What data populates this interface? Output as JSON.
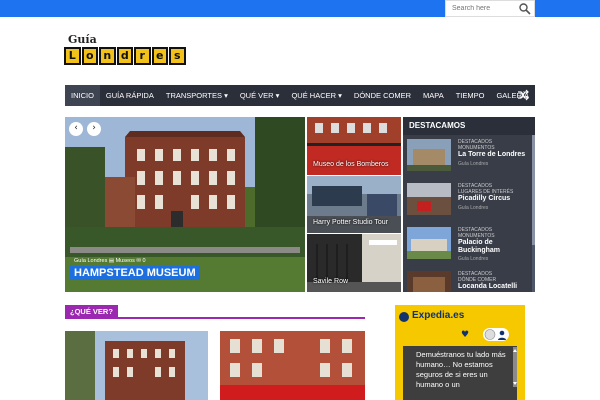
{
  "search": {
    "placeholder": "Search here"
  },
  "logo": {
    "small": "Guía",
    "letters": [
      "L",
      "o",
      "n",
      "d",
      "r",
      "e",
      "s"
    ]
  },
  "nav": {
    "items": [
      "INICIO",
      "GUÍA RÁPIDA",
      "TRANSPORTES ▾",
      "QUÉ VER ▾",
      "QUÉ HACER ▾",
      "DÓNDE COMER",
      "MAPA",
      "TIEMPO",
      "GALERÍA"
    ],
    "active": "INICIO"
  },
  "hero": {
    "prev": "‹",
    "next": "›",
    "meta": "Guía Londres  ▤ Museos  ✉ 0",
    "title": "HAMPSTEAD MUSEUM"
  },
  "tiles": [
    {
      "caption": "Museo de los Bomberos"
    },
    {
      "caption": "Harry Potter Studio Tour"
    },
    {
      "caption": "Savile Row"
    }
  ],
  "destacamos": {
    "heading": "DESTACAMOS",
    "items": [
      {
        "cat1": "DESTACADOS",
        "cat2": "MONUMENTOS",
        "title": "La Torre de Londres",
        "author": "Guía Londres"
      },
      {
        "cat1": "DESTACADOS",
        "cat2": "LUGARES DE INTERÉS",
        "title": "Picadilly Circus",
        "author": "Guía Londres"
      },
      {
        "cat1": "DESTACADOS",
        "cat2": "MONUMENTOS",
        "title": "Palacio de Buckingham",
        "author": "Guía Londres"
      },
      {
        "cat1": "DESTACADOS",
        "cat2": "DÓNDE COMER",
        "title": "Locanda Locatelli",
        "author": ""
      }
    ]
  },
  "section": {
    "label": "¿QUÉ VER?"
  },
  "ad": {
    "brand": "Expedia.es",
    "message": "Demuéstranos tu lado más humano… No estamos seguros de si eres un humano o un"
  },
  "colors": {
    "topbar": "#1e73f0",
    "nav": "#2a2f3a",
    "accent": "#9c27b0",
    "hero_label": "#1d6fe0",
    "ad": "#f6c800"
  }
}
